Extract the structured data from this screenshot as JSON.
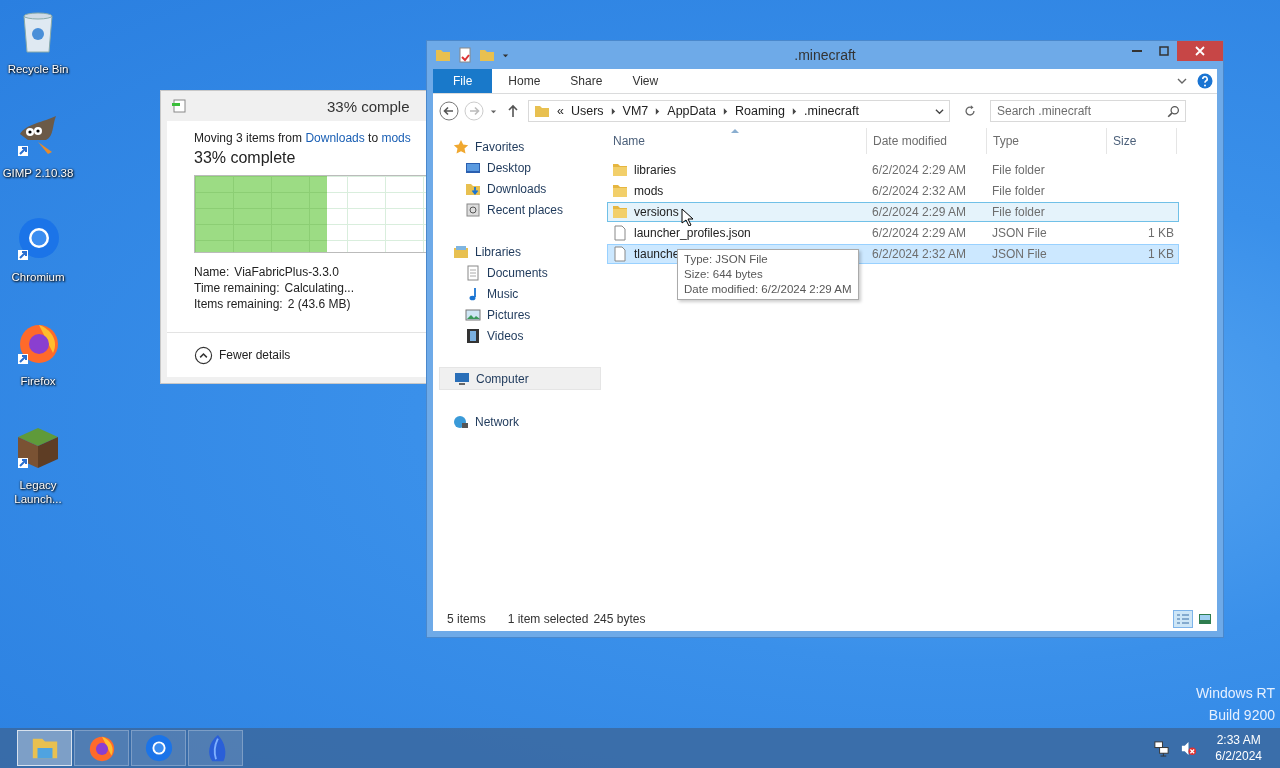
{
  "desktop_icons": [
    {
      "kind": "recycle",
      "label": "Recycle Bin"
    },
    {
      "kind": "gimp",
      "label": "GIMP 2.10.38"
    },
    {
      "kind": "chromium",
      "label": "Chromium"
    },
    {
      "kind": "firefox",
      "label": "Firefox"
    },
    {
      "kind": "block",
      "label": "Legacy Launch..."
    }
  ],
  "os_label": [
    "Windows RT",
    "Build 9200"
  ],
  "progress_dialog": {
    "title": "33% comple",
    "message": {
      "prefix": "Moving 3 items from",
      "source": "Downloads",
      "middle": "to",
      "target": "mods"
    },
    "heading": "33% complete",
    "level": 0.33,
    "details": [
      {
        "label": "Name:",
        "value": "ViaFabricPlus-3.3.0"
      },
      {
        "label": "Time remaining:",
        "value": "Calculating..."
      },
      {
        "label": "Items remaining:",
        "value": "2 (43.6 MB)"
      }
    ],
    "toggle": "Fewer details"
  },
  "explorer": {
    "title": ".minecraft",
    "tabs": [
      {
        "label": "File",
        "selected": true
      },
      {
        "label": "Home",
        "selected": false
      },
      {
        "label": "Share",
        "selected": false
      },
      {
        "label": "View",
        "selected": false
      }
    ],
    "breadcrumb": [
      "«",
      "Users",
      "VM7",
      "AppData",
      "Roaming",
      ".minecraft"
    ],
    "search": {
      "placeholder": "Search .minecraft"
    },
    "nav": [
      {
        "kind": "favorites",
        "label": "Favorites",
        "selected": false,
        "children": [
          {
            "kind": "desktop",
            "label": "Desktop",
            "selected": false
          },
          {
            "kind": "downloads",
            "label": "Downloads",
            "selected": false
          },
          {
            "kind": "recent",
            "label": "Recent places",
            "selected": false
          }
        ]
      },
      {
        "kind": "libraries",
        "label": "Libraries",
        "selected": false,
        "children": [
          {
            "kind": "documents",
            "label": "Documents",
            "selected": false
          },
          {
            "kind": "music",
            "label": "Music",
            "selected": false
          },
          {
            "kind": "pictures",
            "label": "Pictures",
            "selected": false
          },
          {
            "kind": "videos",
            "label": "Videos",
            "selected": false
          }
        ]
      },
      {
        "kind": "computer",
        "label": "Computer",
        "selected": true
      },
      {
        "kind": "network",
        "label": "Network",
        "selected": false
      }
    ],
    "columns": [
      "Name",
      "Date modified",
      "Type",
      "Size"
    ],
    "rows": [
      {
        "kind": "folder",
        "name": "libraries",
        "date": "6/2/2024 2:29 AM",
        "type": "File folder",
        "hovered": false,
        "selected": false
      },
      {
        "kind": "folder",
        "name": "mods",
        "date": "6/2/2024 2:32 AM",
        "type": "File folder",
        "hovered": false,
        "selected": false
      },
      {
        "kind": "folder",
        "name": "versions",
        "date": "6/2/2024 2:29 AM",
        "type": "File folder",
        "hovered": true,
        "selected": false
      },
      {
        "kind": "file",
        "name": "launcher_profiles.json",
        "date": "6/2/2024 2:29 AM",
        "type": "JSON File",
        "size": "1 KB",
        "hovered": false,
        "selected": false
      },
      {
        "kind": "file",
        "name": "tlaunche",
        "date": "6/2/2024 2:32 AM",
        "type": "JSON File",
        "size": "1 KB",
        "hovered": false,
        "selected": true
      }
    ],
    "tooltip": [
      "Type: JSON File",
      "Size: 644 bytes",
      "Date modified: 6/2/2024 2:29 AM"
    ],
    "status": {
      "count": "5 items",
      "selection": "1 item selected",
      "size": "245 bytes"
    },
    "views": [
      {
        "kind": "details",
        "selected": true
      },
      {
        "kind": "large",
        "selected": false
      }
    ]
  },
  "taskbar": {
    "apps": [
      {
        "kind": "explorer",
        "selected": true
      },
      {
        "kind": "firefox",
        "selected": false
      },
      {
        "kind": "chromium",
        "selected": false
      },
      {
        "kind": "wing",
        "selected": false
      }
    ],
    "time": "2:33 AM",
    "date": "6/2/2024"
  }
}
